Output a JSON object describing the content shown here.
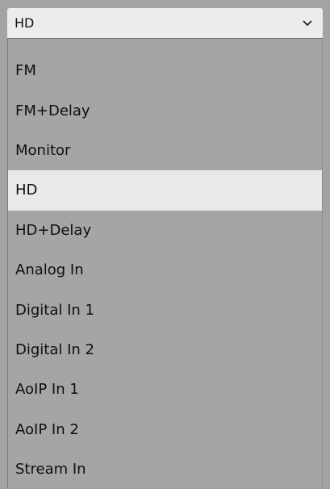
{
  "select": {
    "value": "HD"
  },
  "options": [
    {
      "label": "FM",
      "selected": false
    },
    {
      "label": "FM+Delay",
      "selected": false
    },
    {
      "label": "Monitor",
      "selected": false
    },
    {
      "label": "HD",
      "selected": true
    },
    {
      "label": "HD+Delay",
      "selected": false
    },
    {
      "label": "Analog In",
      "selected": false
    },
    {
      "label": "Digital In 1",
      "selected": false
    },
    {
      "label": "Digital In 2",
      "selected": false
    },
    {
      "label": "AoIP In 1",
      "selected": false
    },
    {
      "label": "AoIP In 2",
      "selected": false
    },
    {
      "label": "Stream In",
      "selected": false
    }
  ],
  "colors": {
    "background": "#a3a3a3",
    "select_bg": "#ececec",
    "selected_option_bg": "#e9e9ec"
  },
  "icons": {
    "dropdown": "chevron-down-icon"
  }
}
